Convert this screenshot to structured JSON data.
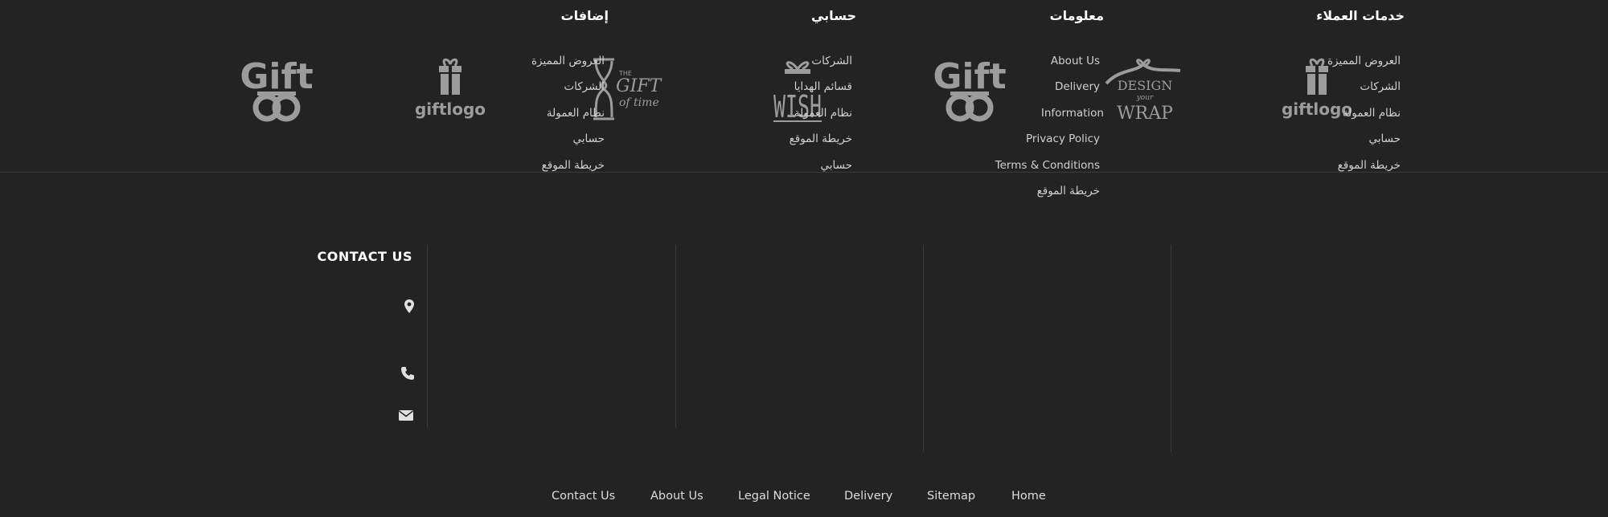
{
  "brand_logos": [
    {
      "name": "gift-knot-logo",
      "text": "Gift"
    },
    {
      "name": "giftlogo-box-logo",
      "text": "giftlogo"
    },
    {
      "name": "gift-of-time-logo",
      "text": "THE GIFT of time"
    },
    {
      "name": "wish-logo",
      "text": "WISH"
    },
    {
      "name": "gift-knot-logo-2",
      "text": "Gift"
    },
    {
      "name": "design-your-wrap-logo",
      "text": "DESIGN your WRAP"
    },
    {
      "name": "giftlogo-box-logo-2",
      "text": "giftlogo"
    }
  ],
  "columns": {
    "customer_service": {
      "title": "خدمات العملاء",
      "items": [
        "العروض المميزة",
        "الشركات",
        "نظام العمولة",
        "حسابي",
        "خريطة الموقع"
      ]
    },
    "information": {
      "title": "معلومات",
      "items": [
        "About Us",
        "Delivery",
        "Information",
        "Privacy Policy",
        "Terms & Conditions",
        "خريطة الموقع"
      ]
    },
    "my_account": {
      "title": "حسابي",
      "items": [
        "الشركات",
        "قسائم الهدايا",
        "نظام العمولة",
        "خريطة الموقع",
        "حسابي"
      ]
    },
    "extras": {
      "title": "إضافات",
      "items": [
        "العروض المميزة",
        "الشركات",
        "نظام العمولة",
        "حسابي",
        "خريطة الموقع"
      ]
    }
  },
  "contact": {
    "title": "CONTACT US",
    "icons": [
      "map-pin-icon",
      "phone-icon",
      "envelope-icon"
    ]
  },
  "bottom_links": [
    "Contact Us",
    "About Us",
    "Legal Notice",
    "Delivery",
    "Sitemap",
    "Home"
  ],
  "colors": {
    "background": "#232323",
    "logo_gray": "#9c9c9c",
    "divider": "#3a3a3a",
    "heading": "#ffffff",
    "link": "#d0d0d0"
  }
}
